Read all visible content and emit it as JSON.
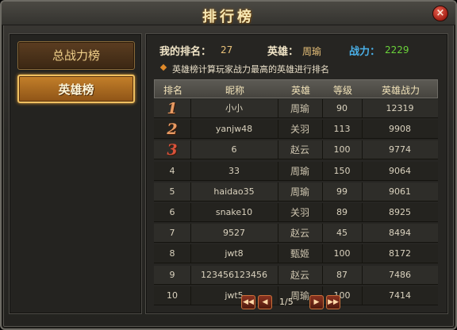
{
  "window": {
    "title": "排行榜",
    "close_symbol": "×"
  },
  "sidebar": {
    "items": [
      {
        "label": "总战力榜",
        "active": false
      },
      {
        "label": "英雄榜",
        "active": true
      }
    ]
  },
  "info": {
    "my_rank_label": "我的排名：",
    "my_rank_value": "27",
    "hero_label": "英雄：",
    "hero_value": "周瑜",
    "power_label": "战力：",
    "power_value": "2229",
    "note": "英雄榜计算玩家战力最高的英雄进行排名"
  },
  "table": {
    "headers": [
      "排名",
      "昵称",
      "英雄",
      "等级",
      "英雄战力"
    ],
    "rows": [
      {
        "rank": "1",
        "name": "小小",
        "hero": "周瑜",
        "level": "90",
        "power": "12319"
      },
      {
        "rank": "2",
        "name": "yanjw48",
        "hero": "关羽",
        "level": "113",
        "power": "9908"
      },
      {
        "rank": "3",
        "name": "6",
        "hero": "赵云",
        "level": "100",
        "power": "9774"
      },
      {
        "rank": "4",
        "name": "33",
        "hero": "周瑜",
        "level": "150",
        "power": "9064"
      },
      {
        "rank": "5",
        "name": "haidao35",
        "hero": "周瑜",
        "level": "99",
        "power": "9061"
      },
      {
        "rank": "6",
        "name": "snake10",
        "hero": "关羽",
        "level": "89",
        "power": "8925"
      },
      {
        "rank": "7",
        "name": "9527",
        "hero": "赵云",
        "level": "45",
        "power": "8494"
      },
      {
        "rank": "8",
        "name": "jwt8",
        "hero": "甄姬",
        "level": "100",
        "power": "8172"
      },
      {
        "rank": "9",
        "name": "123456123456",
        "hero": "赵云",
        "level": "87",
        "power": "7486"
      },
      {
        "rank": "10",
        "name": "jwt5",
        "hero": "周瑜",
        "level": "100",
        "power": "7414"
      }
    ]
  },
  "pagination": {
    "text": "1/5",
    "first_icon": "double-left-arrow",
    "prev_icon": "left-arrow",
    "next_icon": "right-arrow",
    "last_icon": "double-right-arrow"
  },
  "colors": {
    "title": "#f6e7b4",
    "rank_value": "#e9c27a",
    "hero_value": "#e9c27a",
    "power_label": "#4ab0e8",
    "power_value": "#6ad23a",
    "active_tab": "#c4802a"
  }
}
